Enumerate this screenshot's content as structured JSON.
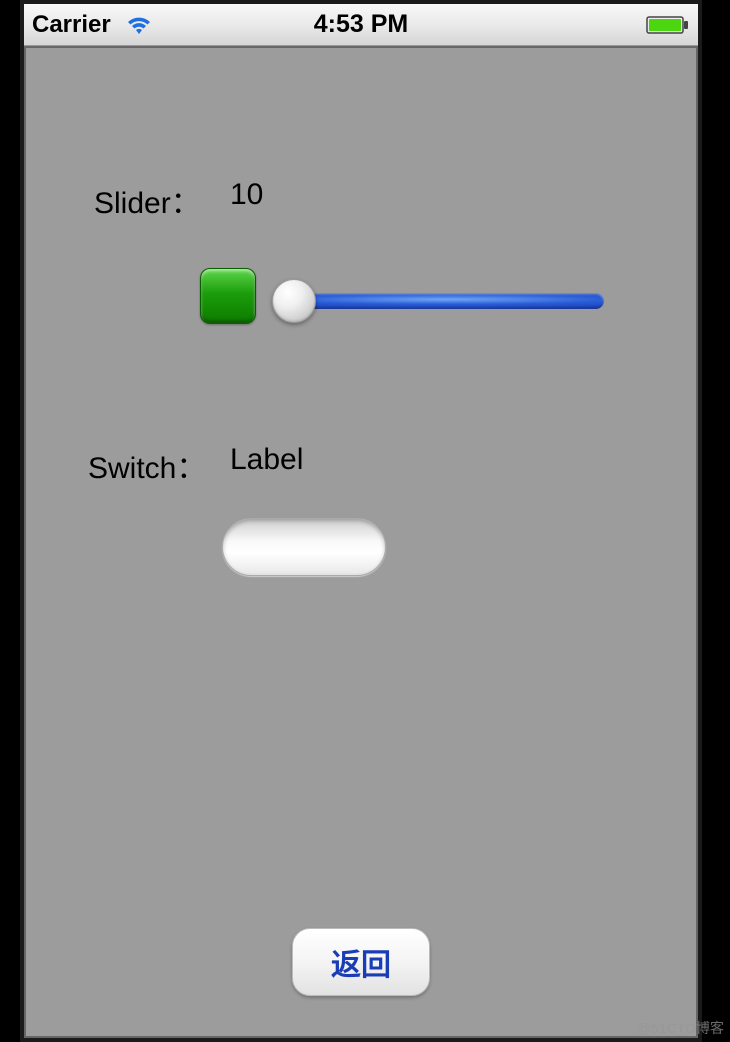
{
  "statusbar": {
    "carrier": "Carrier",
    "time": "4:53 PM"
  },
  "slider": {
    "label": "Slider：",
    "value": "10"
  },
  "switch": {
    "label": "Switch：",
    "value": "Label"
  },
  "buttons": {
    "back": "返回"
  },
  "watermark": "@51CTO博客"
}
